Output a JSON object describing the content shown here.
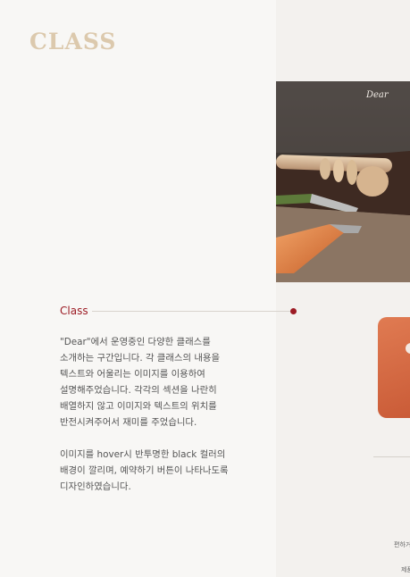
{
  "page": {
    "title": "CLASS"
  },
  "hero": {
    "watermark": "Dear"
  },
  "section": {
    "label": "Class",
    "paragraph_1": "\"Dear\"에서 운영중인 다양한 클래스를 소개하는 구간입니다. 각 클래스의 내용을 텍스트와 어울리는 이미지를 이용하여 설명해주었습니다. 각각의 섹션을 나란히 배열하지 않고 이미지와 텍스트의 위치를 반전시켜주어서 재미를 주었습니다.",
    "paragraph_2": "이미지를 hover시 반투명한 black 컬러의 배경이 깔리며, 예약하기 버튼이 나타나도록 디자인하였습니다."
  },
  "side": {
    "caption_1": "편하거",
    "caption_2": "제품"
  },
  "colors": {
    "title": "#dcc9ad",
    "accent": "#9c1b24",
    "background": "#f8f7f5",
    "card": "#d86a42"
  }
}
